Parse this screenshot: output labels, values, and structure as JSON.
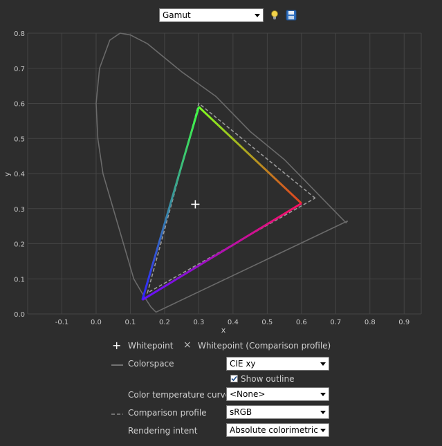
{
  "toolbar": {
    "view_select": "Gamut",
    "icons": [
      "lightbulb-icon",
      "save-icon"
    ]
  },
  "chart_data": {
    "type": "scatter",
    "xlabel": "x",
    "ylabel": "y",
    "xlim": [
      -0.2,
      0.95
    ],
    "ylim": [
      0.0,
      0.8
    ],
    "x_ticks": [
      "-0.1",
      "0.0",
      "0.1",
      "0.2",
      "0.3",
      "0.4",
      "0.5",
      "0.6",
      "0.7",
      "0.8",
      "0.9"
    ],
    "y_ticks": [
      "0.0",
      "0.1",
      "0.2",
      "0.3",
      "0.4",
      "0.5",
      "0.6",
      "0.7",
      "0.8"
    ],
    "grid": true,
    "series": [
      {
        "values": [
          [
            0.6,
            0.315
          ],
          [
            0.3,
            0.59
          ],
          [
            0.135,
            0.04
          ]
        ]
      },
      {
        "values": [
          [
            0.64,
            0.33
          ],
          [
            0.3,
            0.6
          ],
          [
            0.15,
            0.06
          ]
        ]
      }
    ],
    "whitepoint": [
      0.2899,
      0.3125
    ],
    "spectral_locus": [
      [
        0.175,
        0.005
      ],
      [
        0.17,
        0.01
      ],
      [
        0.16,
        0.02
      ],
      [
        0.14,
        0.05
      ],
      [
        0.11,
        0.1
      ],
      [
        0.08,
        0.2
      ],
      [
        0.05,
        0.3
      ],
      [
        0.02,
        0.4
      ],
      [
        0.005,
        0.5
      ],
      [
        0.0,
        0.6
      ],
      [
        0.01,
        0.7
      ],
      [
        0.04,
        0.78
      ],
      [
        0.07,
        0.8
      ],
      [
        0.1,
        0.795
      ],
      [
        0.15,
        0.77
      ],
      [
        0.25,
        0.69
      ],
      [
        0.35,
        0.62
      ],
      [
        0.45,
        0.52
      ],
      [
        0.55,
        0.44
      ],
      [
        0.65,
        0.34
      ],
      [
        0.73,
        0.26
      ],
      [
        0.735,
        0.265
      ]
    ],
    "colors": {
      "background": "#2d2d2d",
      "grid": "#454545",
      "axis_text": "#c8c8c8",
      "locus": "#6a6a6a",
      "comparison": "#9a9a9a",
      "whitepoint": "#ffffff"
    }
  },
  "controls": {
    "whitepoint_label": "Whitepoint",
    "whitepoint_comparison_label": "Whitepoint (Comparison profile)",
    "colorspace_label": "Colorspace",
    "colorspace_value": "CIE xy",
    "show_outline_label": "Show outline",
    "show_outline_checked": true,
    "color_temp_label": "Color temperature curve",
    "color_temp_value": "<None>",
    "comparison_label": "Comparison profile",
    "comparison_value": "sRGB",
    "rendering_label": "Rendering intent",
    "rendering_value": "Absolute colorimetric"
  }
}
